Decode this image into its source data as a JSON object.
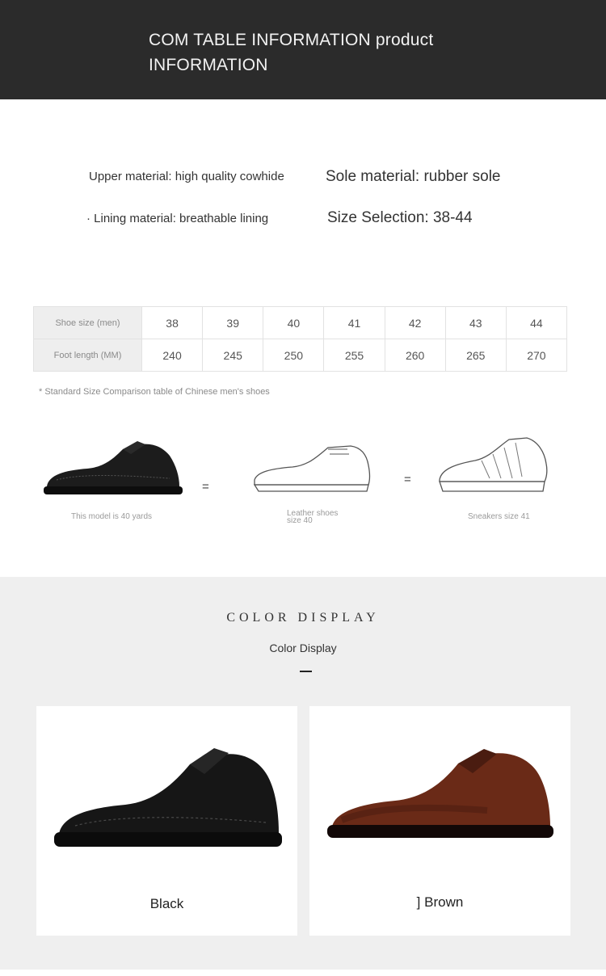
{
  "header": {
    "title": "COM TABLE INFORMATION product INFORMATION"
  },
  "specs": {
    "upper": "Upper material: high quality cowhide",
    "sole": "Sole material: rubber sole",
    "lining": "· Lining material: breathable lining",
    "size_selection": "Size Selection: 38-44"
  },
  "size_table": {
    "row_labels": [
      "Shoe size (men)",
      "Foot length (MM)"
    ],
    "shoe_sizes": [
      "38",
      "39",
      "40",
      "41",
      "42",
      "43",
      "44"
    ],
    "foot_lengths": [
      "240",
      "245",
      "250",
      "255",
      "260",
      "265",
      "270"
    ],
    "note": "* Standard Size Comparison table of Chinese men's shoes"
  },
  "comparison": {
    "model_caption": "This model is 40 yards",
    "leather_caption_line1": "Leather shoes",
    "leather_caption_line2": "size 40",
    "sneaker_caption": "Sneakers size 41",
    "equals": "="
  },
  "color_display": {
    "heading": "COLOR DISPLAY",
    "subheading": "Color Display",
    "colors": [
      {
        "label": "Black",
        "hex": "#161616"
      },
      {
        "label": "] Brown",
        "hex": "#6a2a17"
      }
    ]
  },
  "colors": {
    "header_bg": "#2b2b2b",
    "section_bg": "#efefef"
  }
}
